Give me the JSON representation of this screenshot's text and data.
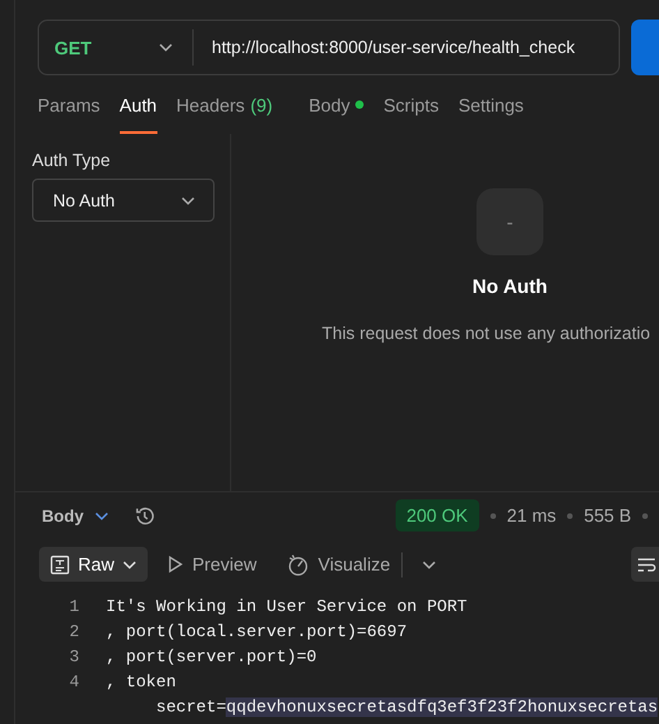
{
  "request": {
    "method": "GET",
    "url": "http://localhost:8000/user-service/health_check"
  },
  "tabs": [
    {
      "label": "Params",
      "selected": false
    },
    {
      "label": "Auth",
      "selected": true
    },
    {
      "label": "Headers",
      "count": "(9)",
      "selected": false
    },
    {
      "label": "Body",
      "dot": true,
      "selected": false
    },
    {
      "label": "Scripts",
      "selected": false
    },
    {
      "label": "Settings",
      "selected": false
    }
  ],
  "auth": {
    "type_label": "Auth Type",
    "type_value": "No Auth",
    "icon_text": "-",
    "title": "No Auth",
    "description": "This request does not use any authorizatio"
  },
  "response": {
    "view_label": "Body",
    "status": "200 OK",
    "time": "21 ms",
    "size": "555 B",
    "modes": [
      {
        "label": "Raw",
        "kind": "raw",
        "selected": true
      },
      {
        "label": "Preview",
        "kind": "preview",
        "selected": false
      },
      {
        "label": "Visualize",
        "kind": "visualize",
        "selected": false
      }
    ],
    "lines": [
      {
        "number": "1",
        "text": "It's Working in User Service on PORT"
      },
      {
        "number": "2",
        "text": ", port(local.server.port)=6697"
      },
      {
        "number": "3",
        "text": ", port(server.port)=0"
      },
      {
        "number": "4",
        "text": ", token",
        "wrapped": [
          {
            "text": "secret=",
            "selected": false
          },
          {
            "text": "qqdevhonuxsecretasdfq3ef3f23f2honuxsecretas",
            "selected": true
          }
        ]
      }
    ]
  }
}
